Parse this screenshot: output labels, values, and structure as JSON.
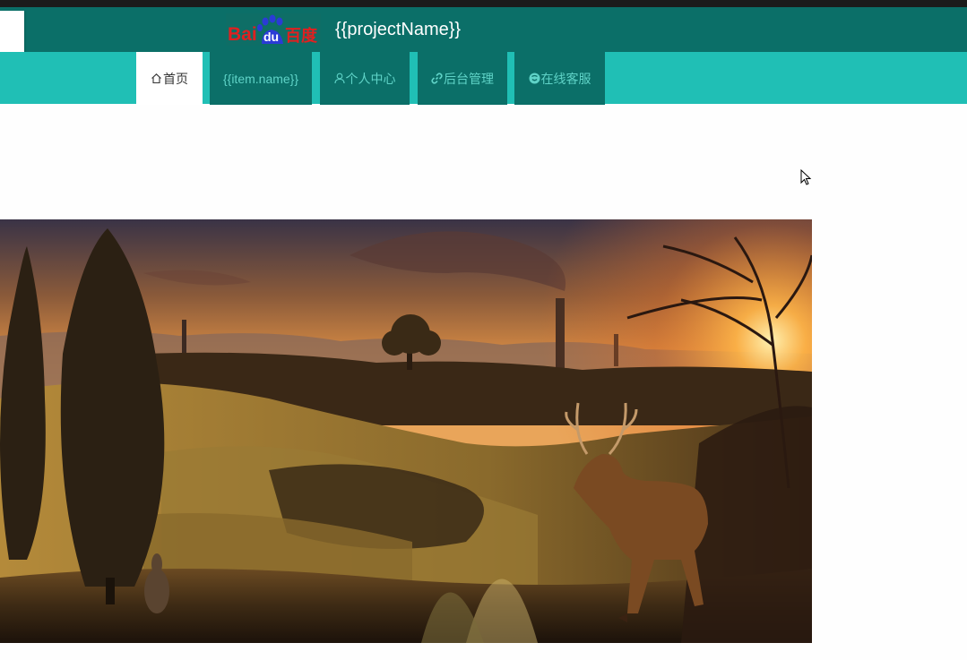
{
  "header": {
    "logo_text": "Bai du 百度",
    "project_name": "{{projectName}}"
  },
  "nav": {
    "items": [
      {
        "label": "首页",
        "icon": "home-icon",
        "active": true
      },
      {
        "label": "{{item.name}}",
        "icon": "",
        "active": false
      },
      {
        "label": "个人中心",
        "icon": "user-icon",
        "active": false
      },
      {
        "label": "后台管理",
        "icon": "link-icon",
        "active": false
      },
      {
        "label": "在线客服",
        "icon": "chat-icon",
        "active": false
      }
    ]
  },
  "colors": {
    "header_bg": "#0b6f68",
    "navbar_bg": "#20bfb5",
    "nav_text": "#5fd3c7",
    "active_tab_bg": "#ffffff"
  },
  "hero": {
    "image": "autumn-landscape-with-deer"
  }
}
